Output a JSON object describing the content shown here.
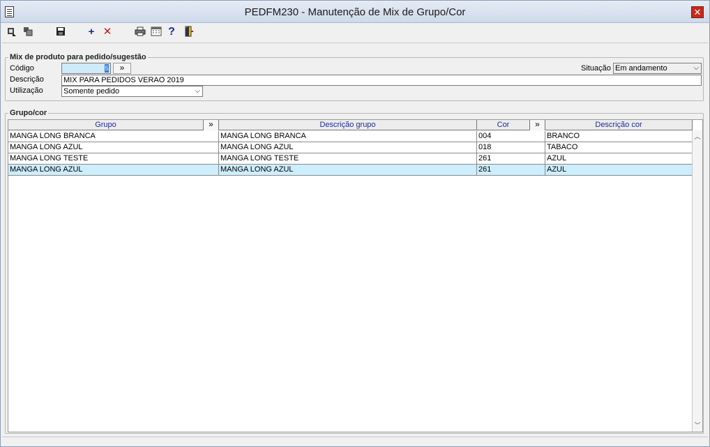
{
  "window": {
    "title": "PEDFM230 - Manutenção de Mix de Grupo/Cor"
  },
  "toolbar": {
    "icons": [
      "first-icon",
      "group-icon",
      "save-icon",
      "add-icon",
      "delete-icon",
      "print-icon",
      "calculator-icon",
      "help-icon",
      "exit-icon"
    ]
  },
  "mix": {
    "legend": "Mix de produto para pedido/sugestão",
    "codigo_label": "Código",
    "codigo_value": "5",
    "lookup": "»",
    "situacao_label": "Situação",
    "situacao_value": "Em andamento",
    "descricao_label": "Descrição",
    "descricao_value": "MIX PARA PEDIDOS VERAO 2019",
    "utilizacao_label": "Utilização",
    "utilizacao_value": "Somente pedido"
  },
  "grupo": {
    "legend": "Grupo/cor",
    "columns": {
      "grupo": "Grupo",
      "descricao_grupo": "Descrição grupo",
      "cor": "Cor",
      "descricao_cor": "Descrição cor",
      "lookup": "»"
    },
    "rows": [
      {
        "grupo": "MANGA LONG BRANCA",
        "descricao_grupo": "MANGA LONG BRANCA",
        "cor": "004",
        "descricao_cor": "BRANCO"
      },
      {
        "grupo": "MANGA LONG AZUL",
        "descricao_grupo": "MANGA LONG AZUL",
        "cor": "018",
        "descricao_cor": "TABACO"
      },
      {
        "grupo": "MANGA LONG TESTE",
        "descricao_grupo": "MANGA LONG TESTE",
        "cor": "261",
        "descricao_cor": "AZUL"
      },
      {
        "grupo": "MANGA LONG AZUL",
        "descricao_grupo": "MANGA LONG AZUL",
        "cor": "261",
        "descricao_cor": "AZUL"
      }
    ],
    "selected_row": 3
  },
  "colors": {
    "selection": "#cdeefc",
    "header_text": "#1a2a9a",
    "close": "#c42b1c"
  }
}
